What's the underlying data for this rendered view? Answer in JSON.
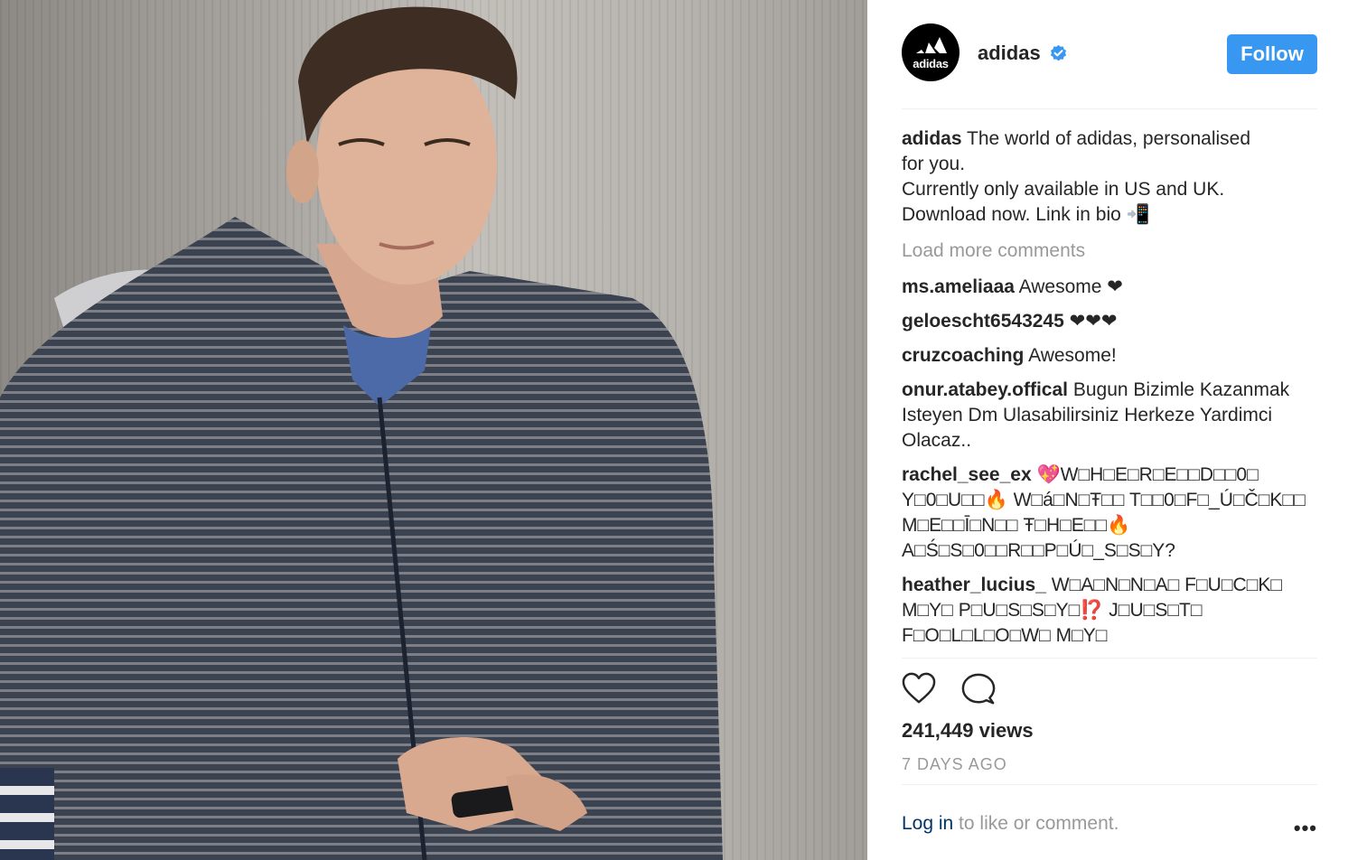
{
  "post": {
    "account": {
      "username": "adidas",
      "verified": true,
      "avatar_text": "adidas",
      "follow_label": "Follow"
    },
    "caption": {
      "username": "adidas",
      "lines": [
        "The world of adidas, personalised",
        "for you.",
        "Currently only available in US and UK.",
        "Download now. Link in bio 📲"
      ]
    },
    "load_more": "Load more comments",
    "comments": [
      {
        "user": "ms.ameliaaa",
        "text": "Awesome ❤"
      },
      {
        "user": "geloescht6543245",
        "text": "❤❤❤"
      },
      {
        "user": "cruzcoaching",
        "text": "Awesome!"
      },
      {
        "user": "onur.atabey.offical",
        "text": "Bugun Bizimle Kazanmak Isteyen Dm Ulasabilirsiniz Herkeze Yardimci Olacaz.."
      },
      {
        "user": "rachel_see_ex",
        "text": "💖W□H□E□R□E□□D□□0□ Y□0□U□□🔥 W□á□N□Ŧ□□ T□□0□F□_Ú□Č□K□□ M□E□□Ī□N□□ Ŧ□H□E□□🔥 A□Ś□S□0□□R□□P□Ú□_S□S□Y?"
      },
      {
        "user": "heather_lucius_",
        "text": "W□A□N□N□A□ F□U□C□K□ M□Y□ P□U□S□S□Y□⁉️ J□U□S□T□ F□O□L□L□O□W□ M□Y□"
      }
    ],
    "views": "241,449 views",
    "time": "7 DAYS AGO",
    "footer": {
      "login_label": "Log in",
      "rest_label": " to like or comment.",
      "more_label": "•••"
    }
  },
  "colors": {
    "follow_button": "#3897f0",
    "verified_badge": "#3897f0",
    "muted_text": "#999999",
    "link_text": "#003569"
  },
  "icons": [
    "adidas-logo-icon",
    "verified-badge-icon",
    "heart-icon",
    "comment-icon",
    "more-options-icon"
  ]
}
